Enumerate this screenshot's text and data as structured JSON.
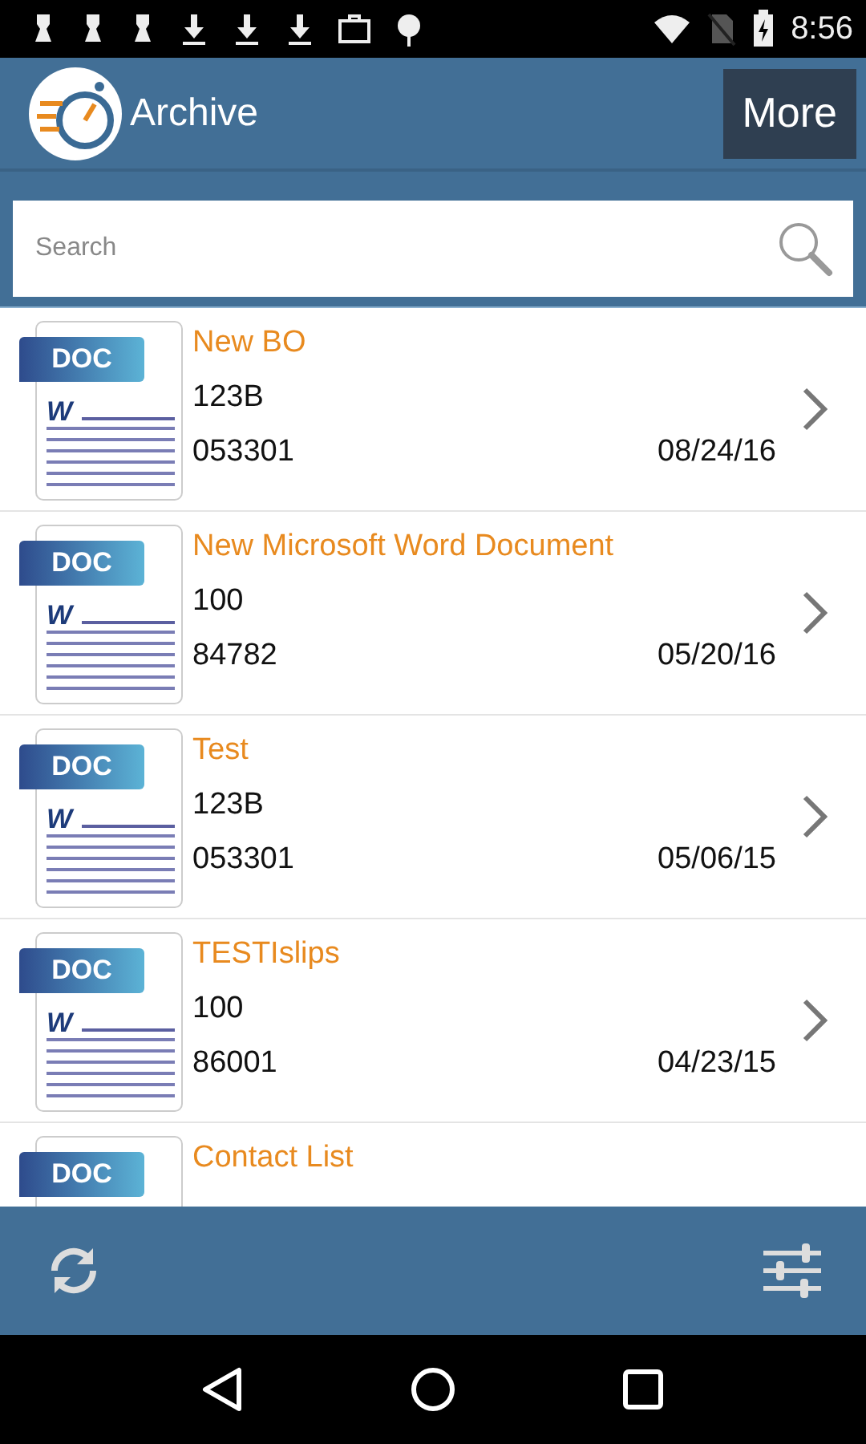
{
  "status_bar": {
    "time": "8:56"
  },
  "header": {
    "title": "Archive",
    "more_button": "More"
  },
  "search": {
    "placeholder": "Search"
  },
  "documents": [
    {
      "badge": "DOC",
      "mark": "W",
      "name": "New BO",
      "code": "123B",
      "number": "053301",
      "date": "08/24/16"
    },
    {
      "badge": "DOC",
      "mark": "W",
      "name": "New Microsoft Word Document",
      "code": "100",
      "number": "84782",
      "date": "05/20/16"
    },
    {
      "badge": "DOC",
      "mark": "W",
      "name": "Test",
      "code": "123B",
      "number": "053301",
      "date": "05/06/15"
    },
    {
      "badge": "DOC",
      "mark": "W",
      "name": "TESTIslips",
      "code": "100",
      "number": "86001",
      "date": "04/23/15"
    },
    {
      "badge": "DOC",
      "name": "Contact List"
    }
  ]
}
